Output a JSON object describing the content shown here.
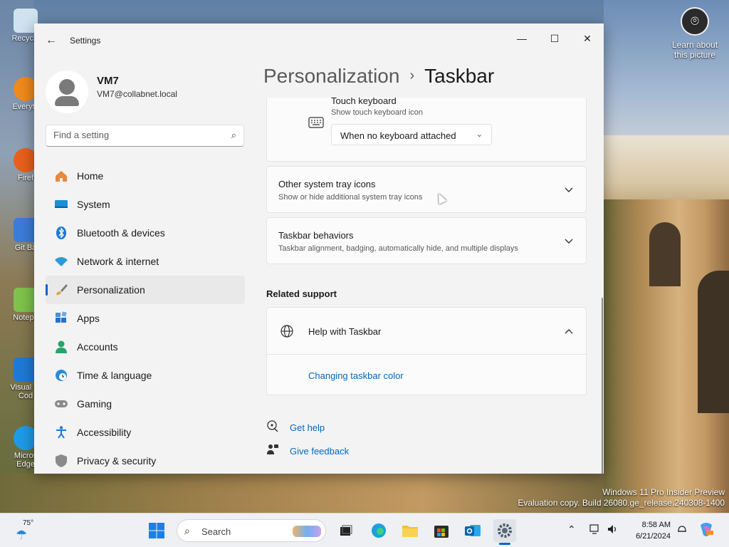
{
  "desktop": {
    "icons": [
      {
        "label": "Recycle"
      },
      {
        "label": "Everyth"
      },
      {
        "label": "Firef"
      },
      {
        "label": "Git Ba"
      },
      {
        "label": "Notepa"
      },
      {
        "label": "Visual St Cod"
      },
      {
        "label": "Micros Edge"
      }
    ],
    "learn_label": "Learn about this picture",
    "watermark_line1": "Windows 11 Pro Insider Preview",
    "watermark_line2": "Evaluation copy. Build 26080.ge_release.240308-1400"
  },
  "window": {
    "title": "Settings",
    "controls": {
      "minimize": "—",
      "maximize": "☐",
      "close": "✕"
    }
  },
  "profile": {
    "name": "VM7",
    "email": "VM7@collabnet.local"
  },
  "search": {
    "placeholder": "Find a setting"
  },
  "nav": {
    "items": [
      {
        "label": "Home",
        "icon": "home-icon",
        "active": false
      },
      {
        "label": "System",
        "icon": "system-icon",
        "active": false
      },
      {
        "label": "Bluetooth & devices",
        "icon": "bluetooth-icon",
        "active": false
      },
      {
        "label": "Network & internet",
        "icon": "wifi-icon",
        "active": false
      },
      {
        "label": "Personalization",
        "icon": "brush-icon",
        "active": true
      },
      {
        "label": "Apps",
        "icon": "apps-icon",
        "active": false
      },
      {
        "label": "Accounts",
        "icon": "accounts-icon",
        "active": false
      },
      {
        "label": "Time & language",
        "icon": "globe-clock-icon",
        "active": false
      },
      {
        "label": "Gaming",
        "icon": "gamepad-icon",
        "active": false
      },
      {
        "label": "Accessibility",
        "icon": "accessibility-icon",
        "active": false
      },
      {
        "label": "Privacy & security",
        "icon": "shield-icon",
        "active": false
      }
    ]
  },
  "breadcrumb": {
    "parent": "Personalization",
    "separator": "›",
    "current": "Taskbar"
  },
  "cards": {
    "touch_keyboard": {
      "title": "Touch keyboard",
      "subtitle": "Show touch keyboard icon",
      "dropdown_value": "When no keyboard attached"
    },
    "tray_icons": {
      "title": "Other system tray icons",
      "subtitle": "Show or hide additional system tray icons"
    },
    "behaviors": {
      "title": "Taskbar behaviors",
      "subtitle": "Taskbar alignment, badging, automatically hide, and multiple displays"
    }
  },
  "related_support": {
    "heading": "Related support",
    "help_title": "Help with Taskbar",
    "link": "Changing taskbar color"
  },
  "footer_links": {
    "get_help": "Get help",
    "give_feedback": "Give feedback"
  },
  "taskbar": {
    "weather_temp": "75°",
    "search_placeholder": "Search",
    "time": "8:58 AM",
    "date": "6/21/2024"
  },
  "colors": {
    "accent": "#0067c0"
  }
}
